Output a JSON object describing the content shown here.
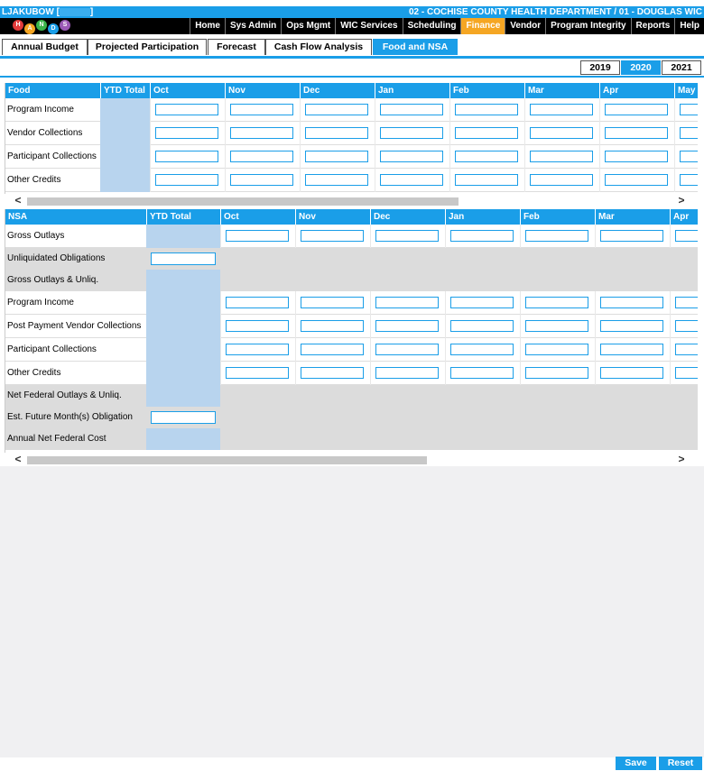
{
  "header": {
    "user": "LJAKUBOW",
    "bracket_open": "[",
    "bracket_close": "]",
    "department": "02 - COCHISE COUNTY HEALTH DEPARTMENT / 01 - DOUGLAS WIC",
    "logo_letters": [
      "H",
      "A",
      "N",
      "D",
      "S"
    ]
  },
  "main_nav": [
    "Home",
    "Sys Admin",
    "Ops Mgmt",
    "WIC Services",
    "Scheduling",
    "Finance",
    "Vendor",
    "Program Integrity",
    "Reports",
    "Help"
  ],
  "active_nav": "Finance",
  "tabs": [
    "Annual Budget",
    "Projected Participation",
    "Forecast",
    "Cash Flow Analysis",
    "Food and NSA"
  ],
  "active_tab": "Food and NSA",
  "years": [
    "2019",
    "2020",
    "2021"
  ],
  "active_year": "2020",
  "food_grid": {
    "label_header": "Food",
    "ytd_header": "YTD Total",
    "months": [
      "Oct",
      "Nov",
      "Dec",
      "Jan",
      "Feb",
      "Mar",
      "Apr",
      "May"
    ],
    "rows": [
      "Program Income",
      "Vendor Collections",
      "Participant Collections",
      "Other Credits"
    ]
  },
  "nsa_grid": {
    "label_header": "NSA",
    "ytd_header": "YTD Total",
    "months": [
      "Oct",
      "Nov",
      "Dec",
      "Jan",
      "Feb",
      "Mar",
      "Apr"
    ],
    "rows": [
      {
        "label": "Gross Outlays",
        "type": "months"
      },
      {
        "label": "Unliquidated Obligations",
        "type": "ytd-input"
      },
      {
        "label": "Gross Outlays & Unliq.",
        "type": "calc"
      },
      {
        "label": "Program Income",
        "type": "months"
      },
      {
        "label": "Post Payment Vendor Collections",
        "type": "months"
      },
      {
        "label": "Participant Collections",
        "type": "months"
      },
      {
        "label": "Other Credits",
        "type": "months"
      },
      {
        "label": "Net Federal Outlays & Unliq.",
        "type": "calc"
      },
      {
        "label": "Est. Future Month(s) Obligation",
        "type": "ytd-input"
      },
      {
        "label": "Annual Net Federal Cost",
        "type": "calc"
      }
    ]
  },
  "scroll_left_glyph": "<",
  "scroll_right_glyph": ">",
  "footer": {
    "save": "Save",
    "reset": "Reset"
  },
  "colors": {
    "accent": "#1a9ee8",
    "active_nav": "#f5a623",
    "ytd_fill": "#b8d4ee",
    "gray": "#dcdcdc"
  }
}
